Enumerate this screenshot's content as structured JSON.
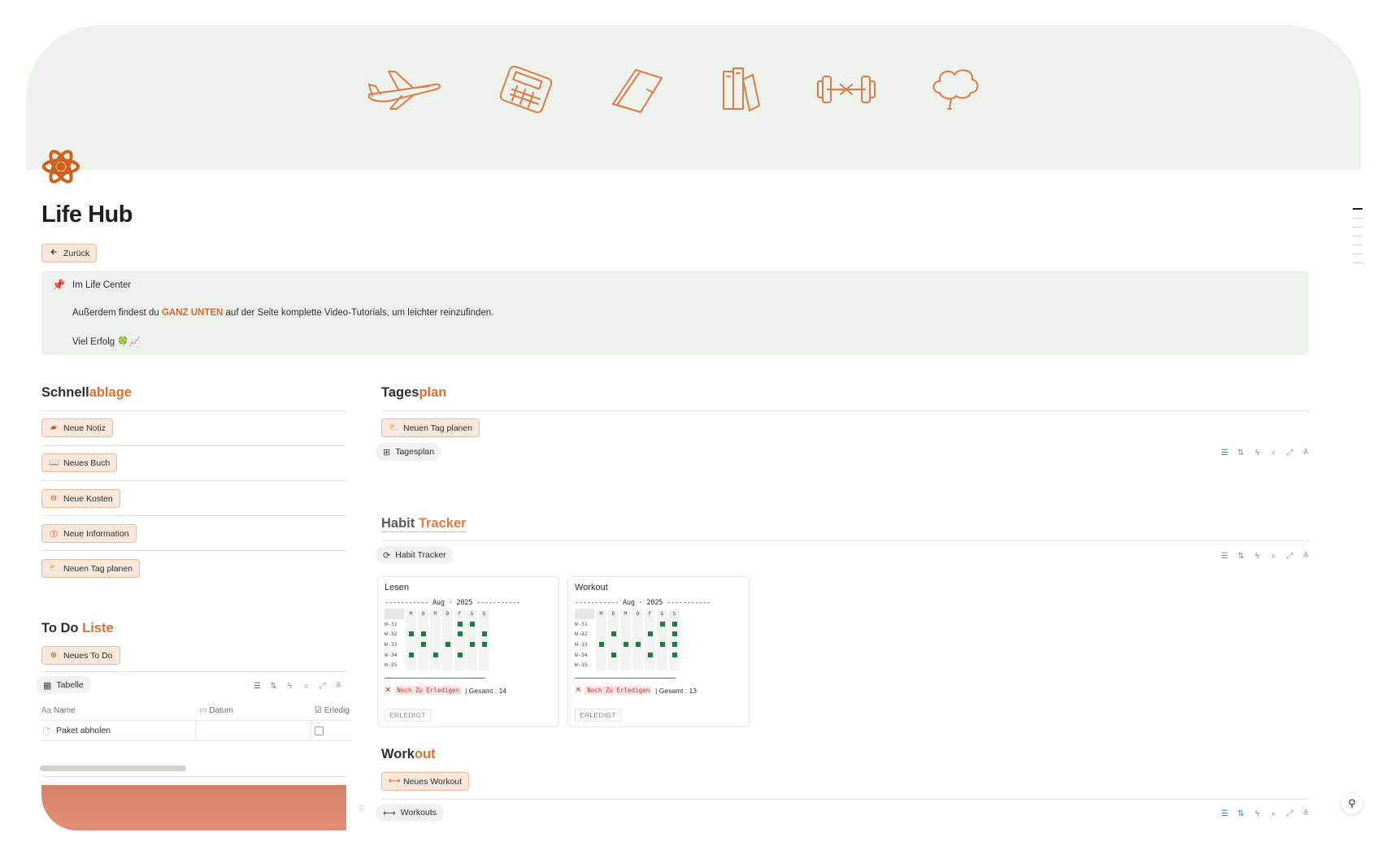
{
  "cover": {
    "icons": [
      "airplane-icon",
      "calculator-icon",
      "planner-icon",
      "books-icon",
      "dumbbell-icon",
      "thought-bubble-icon"
    ],
    "bg_color": "#edf3ec",
    "stroke_color": "#e17a45"
  },
  "page": {
    "icon": "atom-icon",
    "title": "Life Hub"
  },
  "back_button": {
    "label": "Zurück",
    "icon": "arrow-left-icon"
  },
  "callout": {
    "icon": "pushpin-icon",
    "line1": "Im Life Center",
    "line2_before": "Außerdem findest du ",
    "line2_highlight": "GANZ UNTEN",
    "line2_after": " auf der Seite komplette Video-Tutorials, um leichter reinzufinden.",
    "line3": "Viel Erfolg 🍀📈"
  },
  "quick_capture": {
    "heading_plain": "Schnell",
    "heading_accent": "ablage",
    "buttons": [
      {
        "label": "Neue Notiz",
        "icon": "note-icon"
      },
      {
        "label": "Neues Buch",
        "icon": "book-icon"
      },
      {
        "label": "Neue Kosten",
        "icon": "minus-circle-icon"
      },
      {
        "label": "Neue Information",
        "icon": "info-icon"
      },
      {
        "label": "Neuen Tag planen",
        "icon": "sun-cloud-icon"
      }
    ]
  },
  "todo": {
    "heading_plain": "To Do ",
    "heading_accent": "Liste",
    "new_button": "Neues To Do",
    "view_tab": "Tabelle",
    "columns": [
      "Name",
      "Datum",
      "Erledig"
    ],
    "rows": [
      {
        "name": "Paket abholen",
        "date": "",
        "done": false
      }
    ]
  },
  "daily_plan": {
    "heading_plain": "Tages",
    "heading_accent": "plan",
    "new_button": "Neuen Tag planen",
    "view_tab": "Tagesplan"
  },
  "habit_tracker": {
    "heading_plain": "Habit ",
    "heading_accent": "Tracker",
    "view_tab": "Habit Tracker",
    "cards": [
      {
        "title": "Lesen",
        "month_line": "----------- Aug · 2025 -----------",
        "weekdays": [
          "M",
          "D",
          "M",
          "D",
          "F",
          "S",
          "S"
        ],
        "weeks": [
          {
            "label": "W-31",
            "days": [
              0,
              0,
              0,
              0,
              1,
              1,
              0
            ]
          },
          {
            "label": "W-32",
            "days": [
              1,
              1,
              0,
              0,
              1,
              0,
              1
            ]
          },
          {
            "label": "W-33",
            "days": [
              0,
              1,
              0,
              1,
              0,
              1,
              1
            ]
          },
          {
            "label": "W-34",
            "days": [
              1,
              0,
              1,
              0,
              1,
              0,
              0
            ]
          },
          {
            "label": "W-35",
            "days": [
              0,
              0,
              0,
              0,
              0,
              0,
              0
            ]
          }
        ],
        "status": "Noch Zu Erledigen",
        "total": "| Gesamt : 14",
        "tag": "ERLEDIGT"
      },
      {
        "title": "Workout",
        "month_line": "----------- Aug · 2025 -----------",
        "weekdays": [
          "M",
          "D",
          "M",
          "D",
          "F",
          "S",
          "S"
        ],
        "weeks": [
          {
            "label": "W-31",
            "days": [
              0,
              0,
              0,
              0,
              0,
              1,
              1
            ]
          },
          {
            "label": "W-32",
            "days": [
              0,
              1,
              0,
              0,
              1,
              0,
              1
            ]
          },
          {
            "label": "W-33",
            "days": [
              1,
              0,
              1,
              1,
              0,
              1,
              1
            ]
          },
          {
            "label": "W-34",
            "days": [
              0,
              1,
              0,
              0,
              1,
              0,
              1
            ]
          },
          {
            "label": "W-35",
            "days": [
              0,
              0,
              0,
              0,
              0,
              0,
              0
            ]
          }
        ],
        "status": "Noch Zu Erledigen",
        "total": "| Gesamt : 13",
        "tag": "ERLEDIGT"
      }
    ]
  },
  "workout": {
    "heading_plain": "Work",
    "heading_accent": "out",
    "new_button": "Neues Workout",
    "view_tab": "Workouts"
  },
  "toolbar_icons": [
    "filter-icon",
    "sort-icon",
    "automation-icon",
    "search-icon",
    "expand-icon",
    "settings-icon"
  ],
  "accent_color": "#e06e2e",
  "button_bg": "#fbe8dc"
}
